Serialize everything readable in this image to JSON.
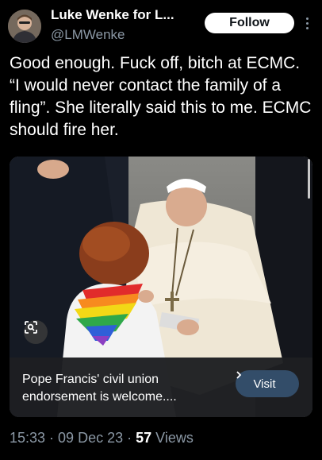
{
  "author": {
    "display_name": "Luke Wenke for L...",
    "handle": "@LMWenke",
    "avatar_icon": "user-photo"
  },
  "follow_label": "Follow",
  "more_icon": "more-vertical-icon",
  "tweet_text": "Good enough.  Fuck off, bitch at ECMC.  “I would never contact the family of a fling”.  She literally said this to me.  ECMC should fire her.",
  "media": {
    "lens_icon": "lens-search-icon",
    "card": {
      "title": "Pope Francis' civil union endorsement is welcome....",
      "visit_label": "Visit",
      "visit_icon": "chevron-right-icon"
    }
  },
  "meta": {
    "time": "15:33",
    "date": "09 Dec 23",
    "separator": " · ",
    "views_count": "57",
    "views_label": " Views"
  },
  "colors": {
    "background": "#000000",
    "secondary_text": "#8b98a5",
    "visit_button": "#334d69"
  }
}
